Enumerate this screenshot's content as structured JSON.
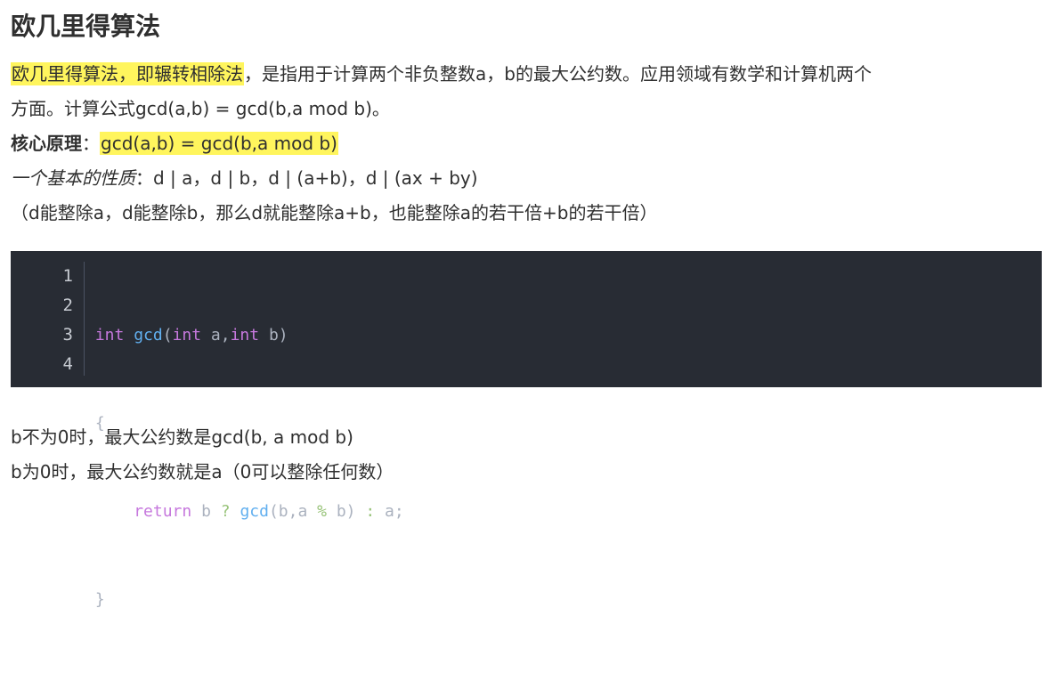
{
  "heading": "欧几里得算法",
  "para1": {
    "highlight": "欧几里得算法，即辗转相除法",
    "rest1": "，是指用于计算两个非负整数a，b的最大公约数。应用领域有数学和计算机两个",
    "line2": "方面。计算公式gcd(a,b) = gcd(b,a mod b)。"
  },
  "principle": {
    "label": "核心原理",
    "sep": "：",
    "formula": "gcd(a,b) = gcd(b,a mod b)"
  },
  "property": {
    "label": "一个基本的性质",
    "sep": "：",
    "text": "d | a，d | b，d | (a+b)，d | (ax + by)"
  },
  "explain": "（d能整除a，d能整除b，那么d就能整除a+b，也能整除a的若干倍+b的若干倍）",
  "code": {
    "line_numbers": [
      "1",
      "2",
      "3",
      "4"
    ],
    "line1": {
      "t1": "int",
      "t2": " ",
      "t3": "gcd",
      "t4": "(",
      "t5": "int",
      "t6": " a,",
      "t7": "int",
      "t8": " b)"
    },
    "line2": "{",
    "line3": {
      "indent": "    ",
      "t1": "return",
      "t2": " b ",
      "t3": "?",
      "t4": " ",
      "t5": "gcd",
      "t6": "(b,a ",
      "t7": "%",
      "t8": " b) ",
      "t9": ":",
      "t10": " a;"
    },
    "line4": "}"
  },
  "bottom": {
    "line1": "b不为0时，最大公约数是gcd(b, a mod b)",
    "line2": "b为0时，最大公约数就是a（0可以整除任何数）"
  },
  "colors": {
    "highlight": "#fff55d",
    "code_bg": "#282c34",
    "keyword": "#c678dd",
    "function": "#61afef",
    "operator": "#98c379"
  }
}
